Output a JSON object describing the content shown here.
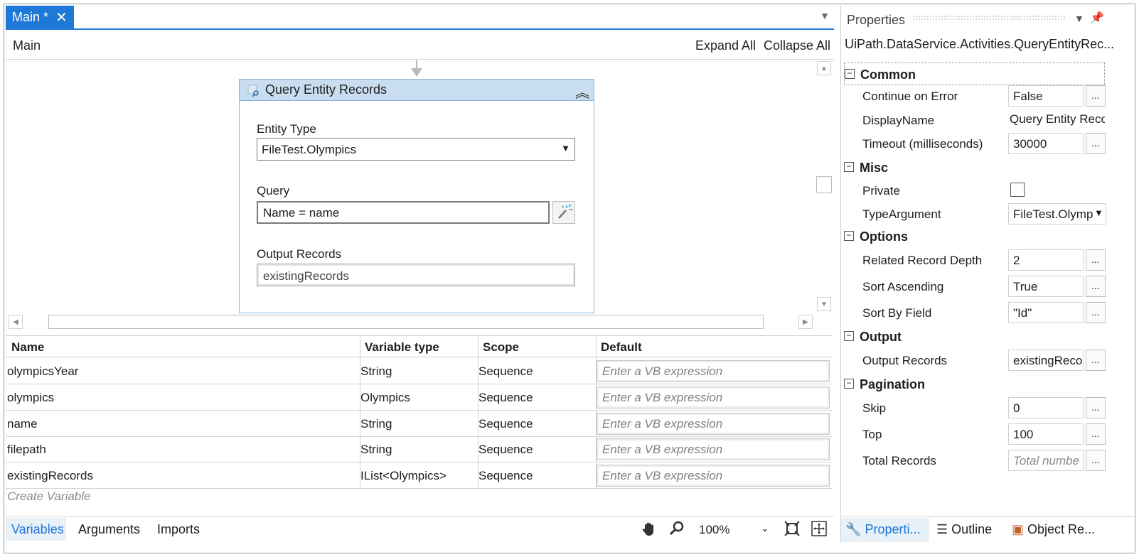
{
  "designer": {
    "tab_label": "Main *",
    "breadcrumb": "Main",
    "expand_all": "Expand All",
    "collapse_all": "Collapse All"
  },
  "activity": {
    "title": "Query Entity Records",
    "entity_type_label": "Entity Type",
    "entity_type_value": "FileTest.Olympics",
    "query_label": "Query",
    "query_value": "Name = name",
    "output_label": "Output Records",
    "output_value": "existingRecords"
  },
  "variables": {
    "headers": [
      "Name",
      "Variable type",
      "Scope",
      "Default"
    ],
    "rows": [
      {
        "name": "olympicsYear",
        "type": "String",
        "scope": "Sequence",
        "default_placeholder": "Enter a VB expression"
      },
      {
        "name": "olympics",
        "type": "Olympics",
        "scope": "Sequence",
        "default_placeholder": "Enter a VB expression"
      },
      {
        "name": "name",
        "type": "String",
        "scope": "Sequence",
        "default_placeholder": "Enter a VB expression"
      },
      {
        "name": "filepath",
        "type": "String",
        "scope": "Sequence",
        "default_placeholder": "Enter a VB expression"
      },
      {
        "name": "existingRecords",
        "type": "IList<Olympics>",
        "scope": "Sequence",
        "default_placeholder": "Enter a VB expression"
      }
    ],
    "create_variable": "Create Variable"
  },
  "bottom_tabs": {
    "variables": "Variables",
    "arguments": "Arguments",
    "imports": "Imports",
    "zoom": "100%"
  },
  "properties": {
    "title": "Properties",
    "class_name": "UiPath.DataService.Activities.QueryEntityRec...",
    "categories": {
      "common": "Common",
      "misc": "Misc",
      "options": "Options",
      "output": "Output",
      "pagination": "Pagination"
    },
    "continue_on_error": {
      "label": "Continue on Error",
      "value": "False"
    },
    "display_name": {
      "label": "DisplayName",
      "value": "Query Entity Reco"
    },
    "timeout": {
      "label": "Timeout (milliseconds)",
      "value": "30000"
    },
    "private": {
      "label": "Private",
      "checked": false
    },
    "type_argument": {
      "label": "TypeArgument",
      "value": "FileTest.Olymp"
    },
    "related_record_depth": {
      "label": "Related Record Depth",
      "value": "2"
    },
    "sort_ascending": {
      "label": "Sort Ascending",
      "value": "True"
    },
    "sort_by_field": {
      "label": "Sort By Field",
      "value": "\"Id\""
    },
    "output_records": {
      "label": "Output Records",
      "value": "existingReco"
    },
    "skip": {
      "label": "Skip",
      "value": "0"
    },
    "top": {
      "label": "Top",
      "value": "100"
    },
    "total_records": {
      "label": "Total Records",
      "placeholder": "Total numbe"
    },
    "tabs": [
      "Properti...",
      "Outline",
      "Object Re..."
    ]
  },
  "colors": {
    "accent": "#1e78d7",
    "activity_header": "#c8ddef"
  }
}
